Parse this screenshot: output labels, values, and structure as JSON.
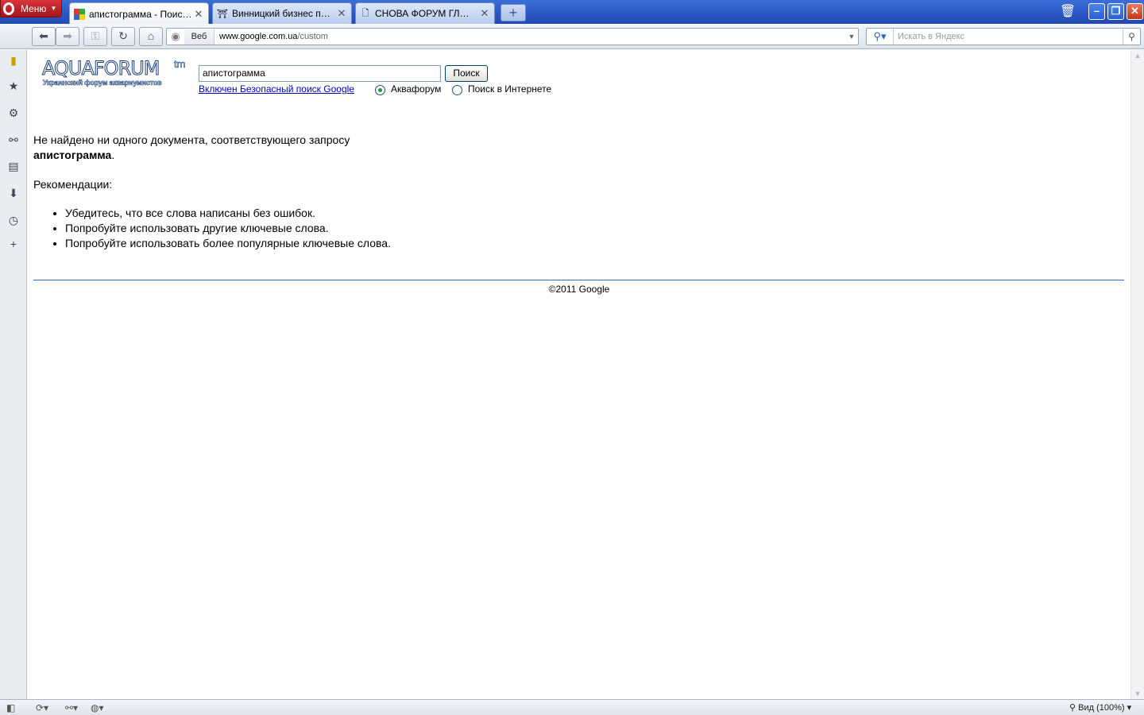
{
  "browser": {
    "menu_label": "Меню",
    "tabs": [
      {
        "title": "апистограмма - Поиск в...",
        "active": true
      },
      {
        "title": "Винницкий бизнес порт...",
        "active": false
      },
      {
        "title": "СНОВА ФОРУМ ГЛЮЧИ...",
        "active": false
      }
    ],
    "address": {
      "badge": "Веб",
      "url_host": "www.google.com.ua",
      "url_path": "/custom"
    },
    "search_placeholder": "Искать в Яндекс",
    "zoom": "Вид (100%)"
  },
  "page": {
    "logo": {
      "main": "AQUAFORUM",
      "tm": "tm",
      "sub": "Украинский форум аквариумистов"
    },
    "query": "апистограмма",
    "search_button": "Поиск",
    "safe_search_link": "Включен Безопасный поиск Google",
    "radio_options": [
      "Аквафорум",
      "Поиск в Интернете"
    ],
    "no_results_text": "Не найдено ни одного документа, соответствующего запросу",
    "query_bold": "апистограмма",
    "recommendations_title": "Рекомендации:",
    "tips": [
      "Убедитесь, что все слова написаны без ошибок.",
      "Попробуйте использовать другие ключевые слова.",
      "Попробуйте использовать более популярные ключевые слова."
    ],
    "footer": "©2011 Google"
  }
}
